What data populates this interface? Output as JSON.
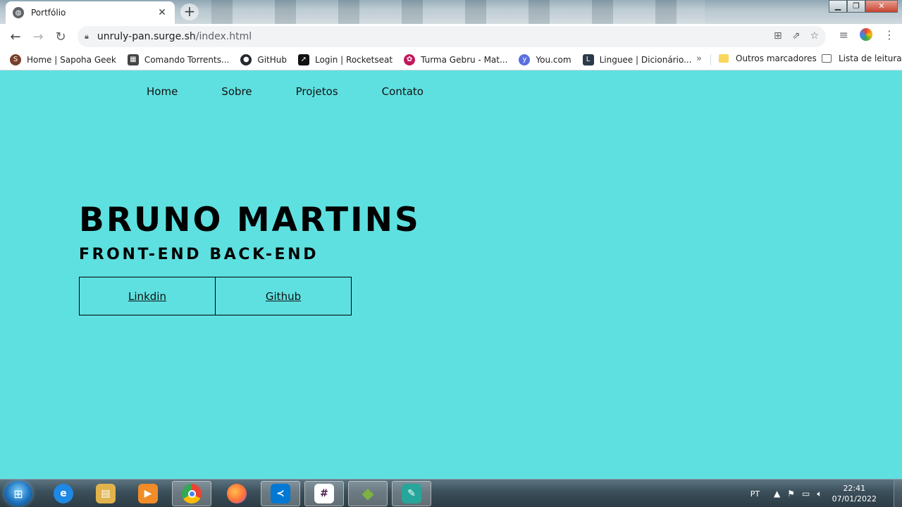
{
  "browser": {
    "tab": {
      "title": "Portfólio",
      "close_glyph": "✕"
    },
    "new_tab_glyph": "+",
    "window_controls": {
      "minimize": "▁",
      "maximize": "❐",
      "close": "✕"
    },
    "address": {
      "host": "unruly-pan.surge.sh",
      "path": "/index.html"
    },
    "bookmarks": [
      {
        "label": "Home | Sapoha Geek",
        "icon": "sapoha-geek-icon",
        "color": "#7a3f2a",
        "glyph": "S"
      },
      {
        "label": "Comando Torrents...",
        "icon": "comando-torrents-icon",
        "color": "#444444",
        "glyph": "▦"
      },
      {
        "label": "GitHub",
        "icon": "github-icon",
        "color": "#24292e",
        "glyph": "●"
      },
      {
        "label": "Login | Rocketseat",
        "icon": "rocketseat-icon",
        "color": "#121214",
        "glyph": "➚"
      },
      {
        "label": "Turma Gebru - Mat...",
        "icon": "gebru-icon",
        "color": "#c2185b",
        "glyph": "✿"
      },
      {
        "label": "You.com",
        "icon": "you-com-icon",
        "color": "#5b6ee1",
        "glyph": "y"
      },
      {
        "label": "Linguee | Dicionário...",
        "icon": "linguee-icon",
        "color": "#2b3a4a",
        "glyph": "L"
      }
    ],
    "more_glyph": "»",
    "other_bookmarks": "Outros marcadores",
    "reading_list": "Lista de leitura"
  },
  "page": {
    "nav": {
      "home": "Home",
      "sobre": "Sobre",
      "projetos": "Projetos",
      "contato": "Contato"
    },
    "name": "BRUNO MARTINS",
    "role": "FRONT-END BACK-END",
    "buttons": {
      "linkedin": "Linkdin",
      "github": "Github"
    },
    "colors": {
      "background": "#5fe0e0",
      "text": "#000000"
    }
  },
  "taskbar": {
    "apps": [
      {
        "name": "internet-explorer",
        "glyph": "e",
        "color": "#1e88e5"
      },
      {
        "name": "file-explorer",
        "glyph": "▤",
        "color": "#e0b34c"
      },
      {
        "name": "media-player",
        "glyph": "▶",
        "color": "#f28c28"
      },
      {
        "name": "chrome",
        "glyph": "◉",
        "color": "#34a853"
      },
      {
        "name": "firefox",
        "glyph": "◐",
        "color": "#ff7139"
      },
      {
        "name": "vscode",
        "glyph": "≺",
        "color": "#0078d4"
      },
      {
        "name": "slack",
        "glyph": "#",
        "color": "#4a154b"
      },
      {
        "name": "git",
        "glyph": "◆",
        "color": "#7cb342"
      },
      {
        "name": "paint",
        "glyph": "✎",
        "color": "#26a69a"
      }
    ],
    "language": "PT",
    "time": "22:41",
    "date": "07/01/2022"
  }
}
